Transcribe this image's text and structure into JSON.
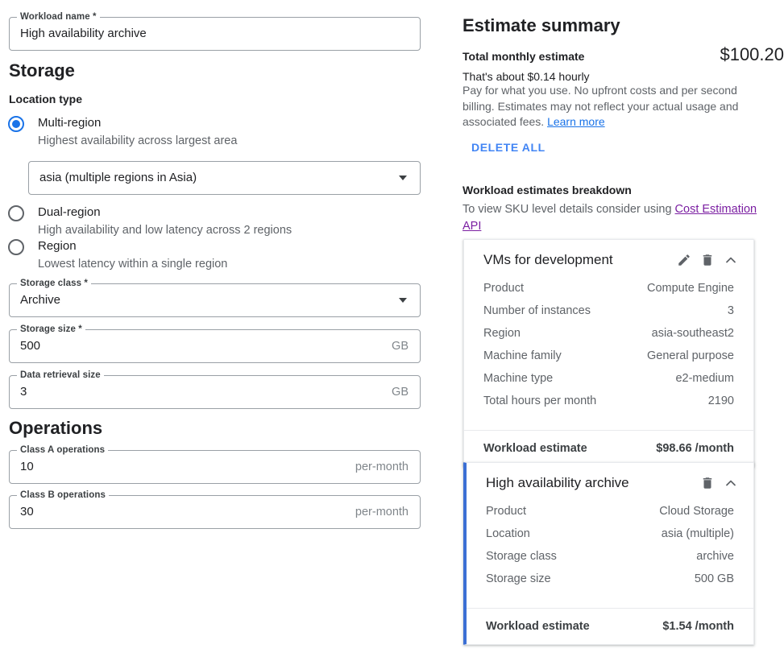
{
  "form": {
    "workload_name": {
      "label": "Workload name *",
      "value": "High availability archive"
    },
    "storage_section_title": "Storage",
    "location_type_label": "Location type",
    "location_options": [
      {
        "label": "Multi-region",
        "sub": "Highest availability across largest area",
        "selected": true
      },
      {
        "label": "Dual-region",
        "sub": "High availability and low latency across 2 regions",
        "selected": false
      },
      {
        "label": "Region",
        "sub": "Lowest latency within a single region",
        "selected": false
      }
    ],
    "multi_region_select": {
      "value": "asia (multiple regions in Asia)",
      "icon": "chevron-down-icon"
    },
    "storage_class": {
      "label": "Storage class *",
      "value": "Archive",
      "icon": "chevron-down-icon"
    },
    "storage_size": {
      "label": "Storage size *",
      "value": "500",
      "suffix": "GB"
    },
    "data_retrieval_size": {
      "label": "Data retrieval size",
      "value": "3",
      "suffix": "GB"
    },
    "operations_section_title": "Operations",
    "class_a_operations": {
      "label": "Class A operations",
      "value": "10",
      "suffix": "per-month"
    },
    "class_b_operations": {
      "label": "Class B operations",
      "value": "30",
      "suffix": "per-month"
    }
  },
  "summary": {
    "title": "Estimate summary",
    "total_label": "Total monthly estimate",
    "total_amount": "$100.20",
    "hourly_text": "That's about $0.14 hourly",
    "fineprint": "Pay for what you use. No upfront costs and per second billing. Estimates may not reflect your actual usage and associated fees.",
    "learn_more": "Learn more",
    "delete_all": "DELETE ALL",
    "breakdown_title": "Workload estimates breakdown",
    "breakdown_prefix": "To view SKU level details consider using ",
    "breakdown_link": "Cost Estimation API"
  },
  "estimates": [
    {
      "title": "VMs for development",
      "selected": false,
      "actions": [
        "edit-icon",
        "delete-icon",
        "collapse-icon"
      ],
      "rows": [
        {
          "k": "Product",
          "v": "Compute Engine"
        },
        {
          "k": "Number of instances",
          "v": "3"
        },
        {
          "k": "Region",
          "v": "asia-southeast2"
        },
        {
          "k": "Machine family",
          "v": "General purpose"
        },
        {
          "k": "Machine type",
          "v": "e2-medium"
        },
        {
          "k": "Total hours per month",
          "v": "2190"
        }
      ],
      "foot_label": "Workload estimate",
      "foot_value": "$98.66 /month"
    },
    {
      "title": "High availability archive",
      "selected": true,
      "actions": [
        "delete-icon",
        "collapse-icon"
      ],
      "rows": [
        {
          "k": "Product",
          "v": "Cloud Storage"
        },
        {
          "k": "Location",
          "v": "asia (multiple)"
        },
        {
          "k": "Storage class",
          "v": "archive"
        },
        {
          "k": "Storage size",
          "v": "500 GB"
        }
      ],
      "foot_label": "Workload estimate",
      "foot_value": "$1.54 /month"
    }
  ],
  "colors": {
    "accent_blue": "#1a73e8",
    "link_purple": "#7b1fa2",
    "selected_border": "#3b6fd4",
    "text_primary": "#202124",
    "text_secondary": "#5f6368"
  }
}
